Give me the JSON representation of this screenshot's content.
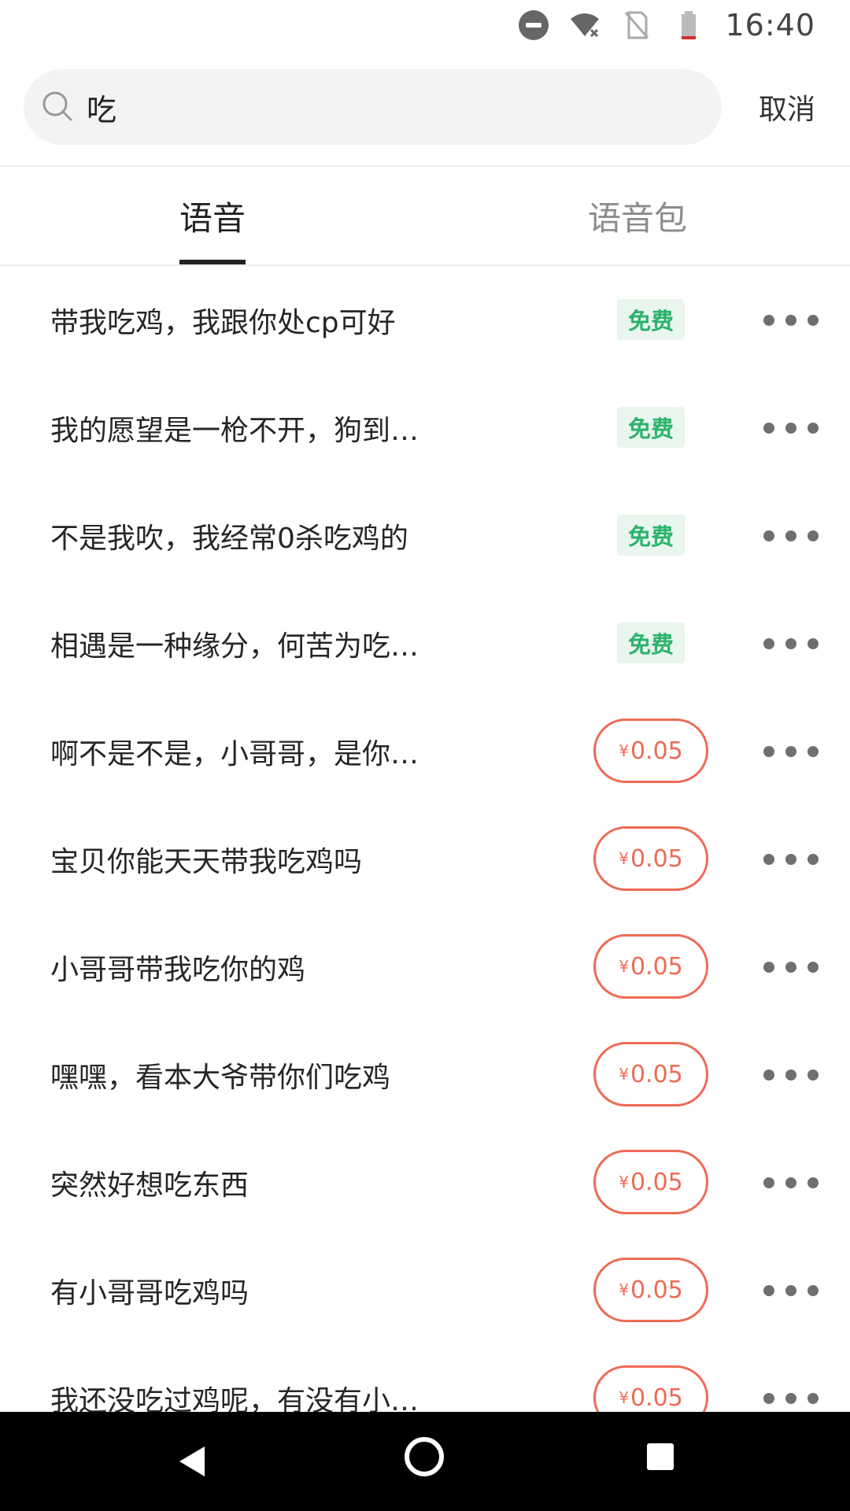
{
  "status_bar": {
    "time": "16:40"
  },
  "search": {
    "query": "吃",
    "cancel_label": "取消"
  },
  "tabs": [
    {
      "label": "语音",
      "active": true
    },
    {
      "label": "语音包",
      "active": false
    }
  ],
  "items": [
    {
      "title": "带我吃鸡，我跟你处cp可好",
      "badge": "免费"
    },
    {
      "title": "我的愿望是一枪不开，狗到…",
      "badge": "免费"
    },
    {
      "title": "不是我吹，我经常0杀吃鸡的",
      "badge": "免费"
    },
    {
      "title": "相遇是一种缘分，何苦为吃…",
      "badge": "免费"
    },
    {
      "title": "啊不是不是，小哥哥，是你…",
      "price": "0.05",
      "currency": "¥"
    },
    {
      "title": "宝贝你能天天带我吃鸡吗",
      "price": "0.05",
      "currency": "¥"
    },
    {
      "title": "小哥哥带我吃你的鸡",
      "price": "0.05",
      "currency": "¥"
    },
    {
      "title": "嘿嘿，看本大爷带你们吃鸡",
      "price": "0.05",
      "currency": "¥"
    },
    {
      "title": "突然好想吃东西",
      "price": "0.05",
      "currency": "¥"
    },
    {
      "title": "有小哥哥吃鸡吗",
      "price": "0.05",
      "currency": "¥"
    },
    {
      "title": "我还没吃过鸡呢，有没有小…",
      "price": "0.05",
      "currency": "¥"
    }
  ],
  "colors": {
    "free_text": "#2db36b",
    "free_bg": "#e8f6ee",
    "price": "#ee6a54"
  }
}
